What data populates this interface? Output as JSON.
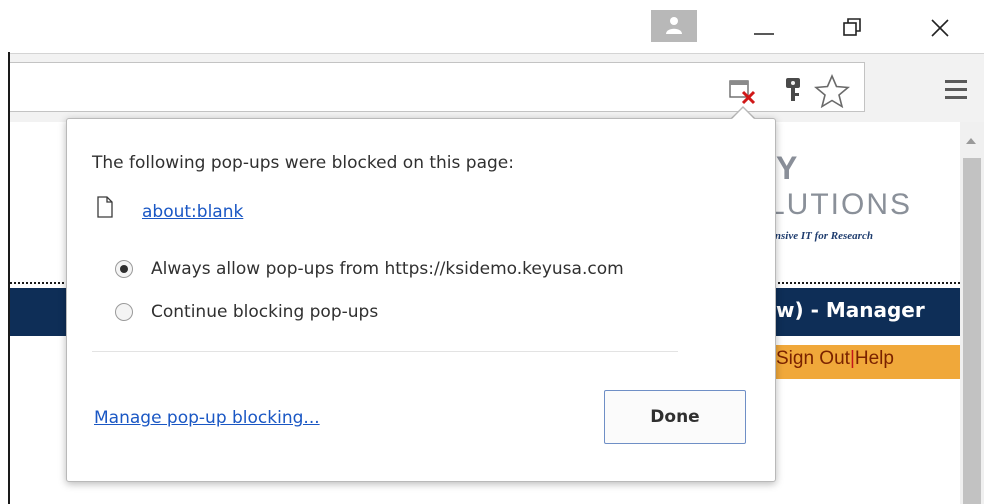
{
  "window": {
    "minimize_icon": "minimize-icon",
    "restore_icon": "restore-icon",
    "close_icon": "close-icon",
    "profile_icon": "profile-avatar-icon"
  },
  "toolbar": {
    "icons": [
      "popup-blocked-icon",
      "key-icon",
      "star-icon",
      "menu-icon"
    ]
  },
  "page_behind": {
    "logo_line1": "Y",
    "logo_line2": "LUTIONS",
    "logo_tagline": "ensive IT for Research",
    "banner_text": "w) - Manager",
    "signout_label": "Sign Out",
    "separator": "|",
    "help_label": "Help"
  },
  "popup_bubble": {
    "heading": "The following pop-ups were blocked on this page:",
    "blocked_items": [
      {
        "label": "about:blank",
        "icon": "document-icon"
      }
    ],
    "options": [
      {
        "label": "Always allow pop-ups from https://ksidemo.keyusa.com",
        "selected": true
      },
      {
        "label": "Continue blocking pop-ups",
        "selected": false
      }
    ],
    "manage_link": "Manage pop-up blocking...",
    "done_button": "Done"
  },
  "colors": {
    "link": "#1a57c4",
    "navy_banner": "#0e2e57",
    "orange_bar": "#f0a83a",
    "done_border": "#6f8fc6"
  }
}
